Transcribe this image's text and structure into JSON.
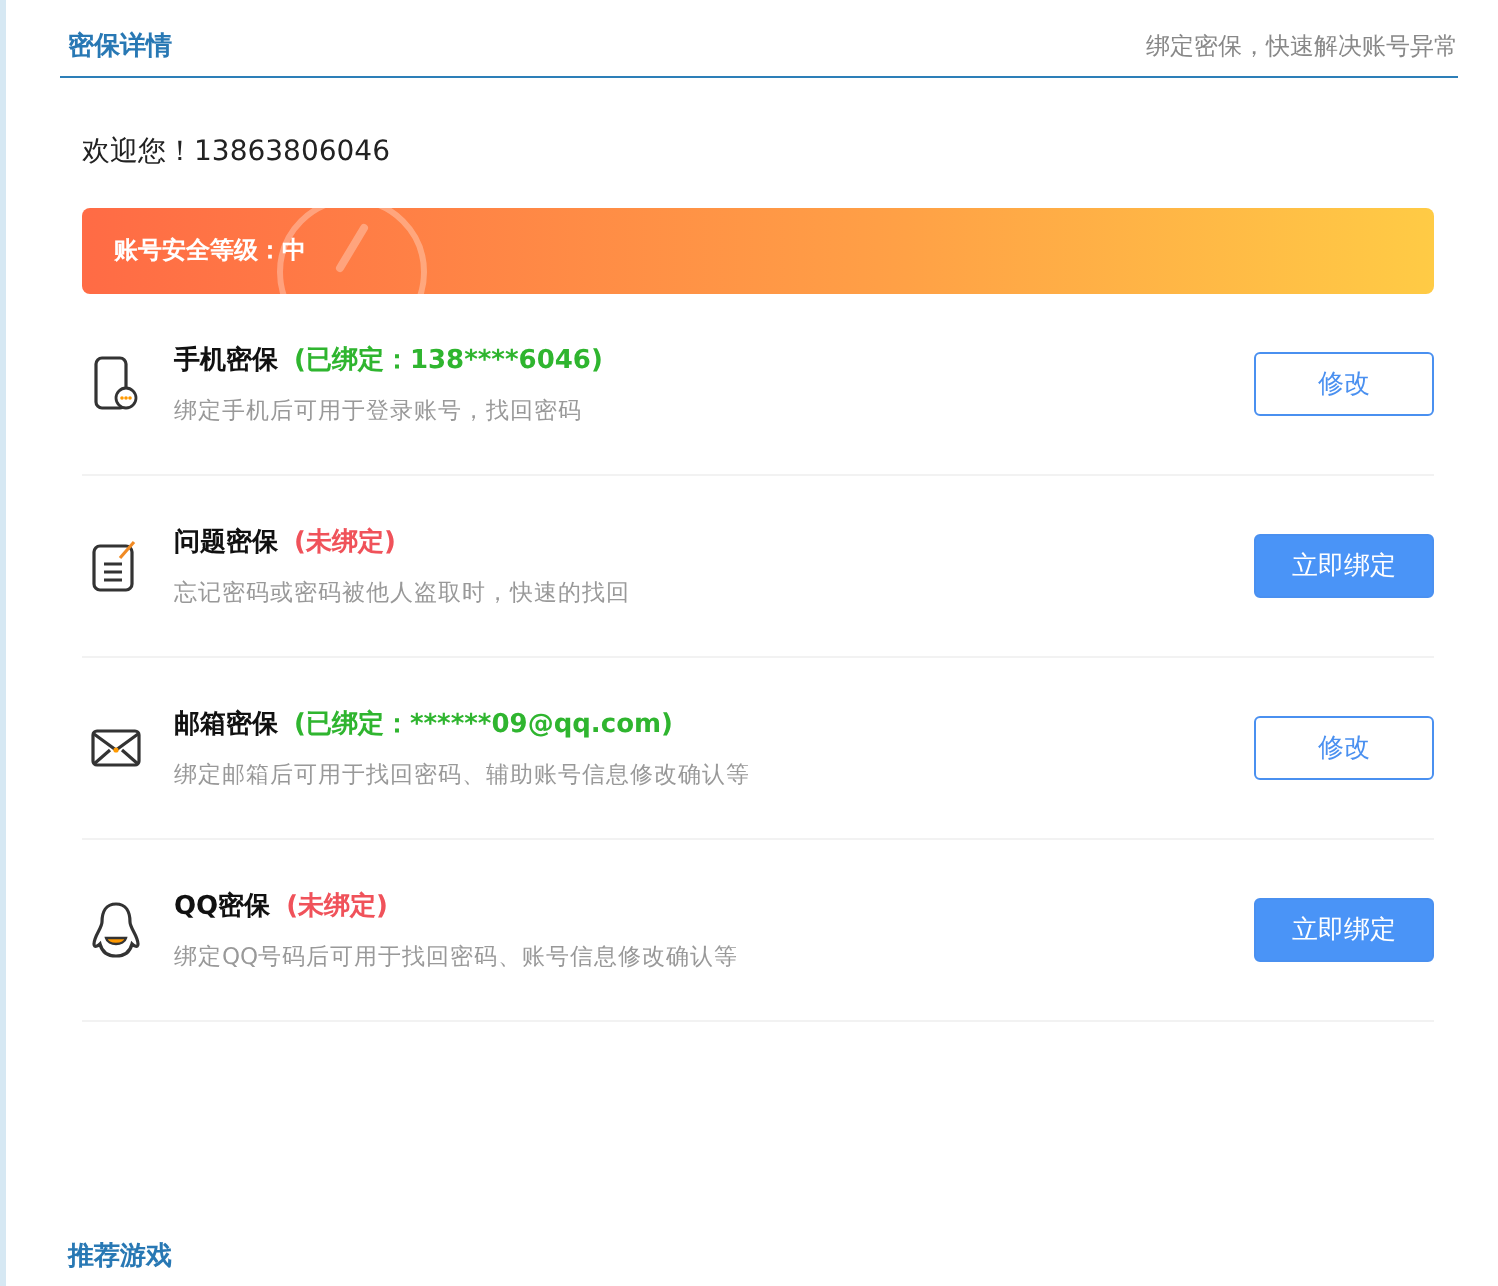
{
  "header": {
    "title": "密保详情",
    "subtitle": "绑定密保，快速解决账号异常"
  },
  "welcome": "欢迎您！13863806046",
  "security_banner": {
    "label": "账号安全等级：中"
  },
  "items": [
    {
      "kind": "phone",
      "title": "手机密保",
      "status": "(已绑定：138****6046)",
      "bound": true,
      "description": "绑定手机后可用于登录账号，找回密码",
      "button": "修改"
    },
    {
      "kind": "note",
      "title": "问题密保",
      "status": "(未绑定)",
      "bound": false,
      "description": "忘记密码或密码被他人盗取时，快速的找回",
      "button": "立即绑定"
    },
    {
      "kind": "mail",
      "title": "邮箱密保",
      "status": "(已绑定：******09@qq.com)",
      "bound": true,
      "description": "绑定邮箱后可用于找回密码、辅助账号信息修改确认等",
      "button": "修改"
    },
    {
      "kind": "penguin",
      "title": "QQ密保",
      "status": "(未绑定)",
      "bound": false,
      "description": "绑定QQ号码后可用于找回密码、账号信息修改确认等",
      "button": "立即绑定"
    }
  ],
  "footer_title": "推荐游戏"
}
